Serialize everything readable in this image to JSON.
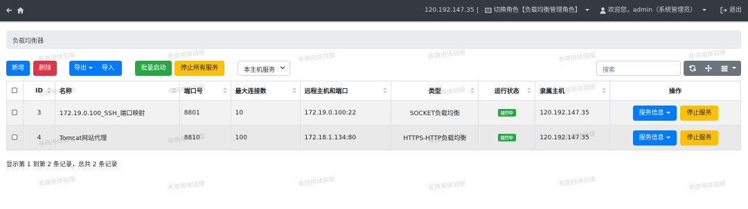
{
  "topbar": {
    "ip": "120.192.147.35",
    "separator": "|",
    "switch_role_label": "切换角色",
    "current_role": "【负载均衡管理角色】",
    "welcome": "欢迎您，",
    "user": "admin（系统管理员）",
    "logout": "退出",
    "bg_color": "#343a40"
  },
  "breadcrumb": {
    "label": "负载均衡器"
  },
  "toolbar": {
    "add": "新增",
    "delete": "删除",
    "export": "导出",
    "import": "导入",
    "batch_start": "批量启动",
    "stop_all": "停止所有服务",
    "scope_select": "本主机服务",
    "search_placeholder": "搜索",
    "icons": [
      "refresh-icon",
      "move-icon",
      "columns-icon"
    ]
  },
  "table": {
    "headers": {
      "id": "ID",
      "name": "名称",
      "port": "端口号",
      "max_conn": "最大连接数",
      "remote": "远程主机和端口",
      "type": "类型",
      "status": "运行状态",
      "host": "隶属主机",
      "actions": "操作"
    },
    "rows": [
      {
        "id": "3",
        "name": "172.19.0.100_SSH_端口映射",
        "port": "8801",
        "max_conn": "10",
        "remote": "172.19.0.100:22",
        "type": "SOCKET负载均衡",
        "status": "运行中",
        "host": "120.192.147.35",
        "info_btn": "服务信息",
        "stop_btn": "停止服务"
      },
      {
        "id": "4",
        "name": "Tomcat网站代理",
        "port": "8810",
        "max_conn": "100",
        "remote": "172.18.1.134:80",
        "type": "HTTPS-HTTP负载均衡",
        "status": "运行中",
        "host": "120.192.147.35",
        "info_btn": "服务信息",
        "stop_btn": "停止服务"
      }
    ]
  },
  "footer": {
    "summary": "显示第 1 到第 2 条记录，总共 2 条记录"
  },
  "watermark": "非商用体验版",
  "colors": {
    "primary": "#007bff",
    "danger": "#dc3545",
    "success": "#28a745",
    "warning": "#ffc107",
    "secondary": "#6c757d"
  }
}
